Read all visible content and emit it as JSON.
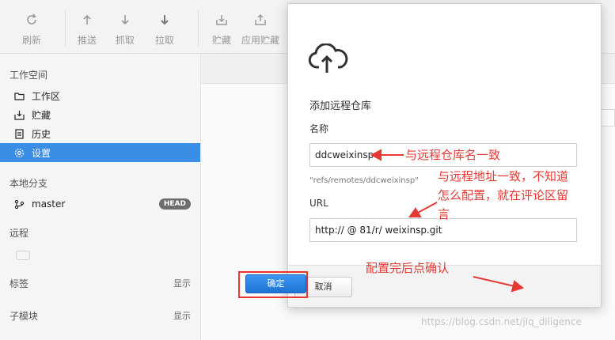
{
  "toolbar": {
    "refresh": "刷新",
    "push": "推送",
    "fetch": "抓取",
    "pull": "拉取",
    "stash": "贮藏",
    "apply_stash": "应用贮藏"
  },
  "sidebar": {
    "workspace_title": "工作空间",
    "items": [
      {
        "label": "工作区",
        "icon": "folder-icon"
      },
      {
        "label": "贮藏",
        "icon": "stash-icon"
      },
      {
        "label": "历史",
        "icon": "history-icon"
      },
      {
        "label": "设置",
        "icon": "gear-icon"
      }
    ],
    "branches_title": "本地分支",
    "branch": {
      "name": "master",
      "badge": "HEAD"
    },
    "remotes_title": "远程",
    "tags_title": "标签",
    "tags_action": "显示",
    "submodules_title": "子模块",
    "submodules_action": "显示"
  },
  "dialog": {
    "heading": "添加远程仓库",
    "name_label": "名称",
    "name_value": "ddcweixinsp",
    "ref_hint": "\"refs/remotes/ddcweixinsp\"",
    "url_label": "URL",
    "url_value": "http://                 @                         81/r/      weixinsp.git",
    "cancel": "取消",
    "ok": "确定"
  },
  "annotations": {
    "name_note": "与远程仓库名一致",
    "url_note_1": "与远程地址一致，不知道",
    "url_note_2": "怎么配置，就在评论区留",
    "url_note_3": "言",
    "confirm_note": "配置完后点确认",
    "color": "#e53935"
  },
  "watermark": "https://blog.csdn.net/jlq_diligence",
  "colors": {
    "accent": "#3a8ee6",
    "ok_button": "#1f73d4"
  }
}
